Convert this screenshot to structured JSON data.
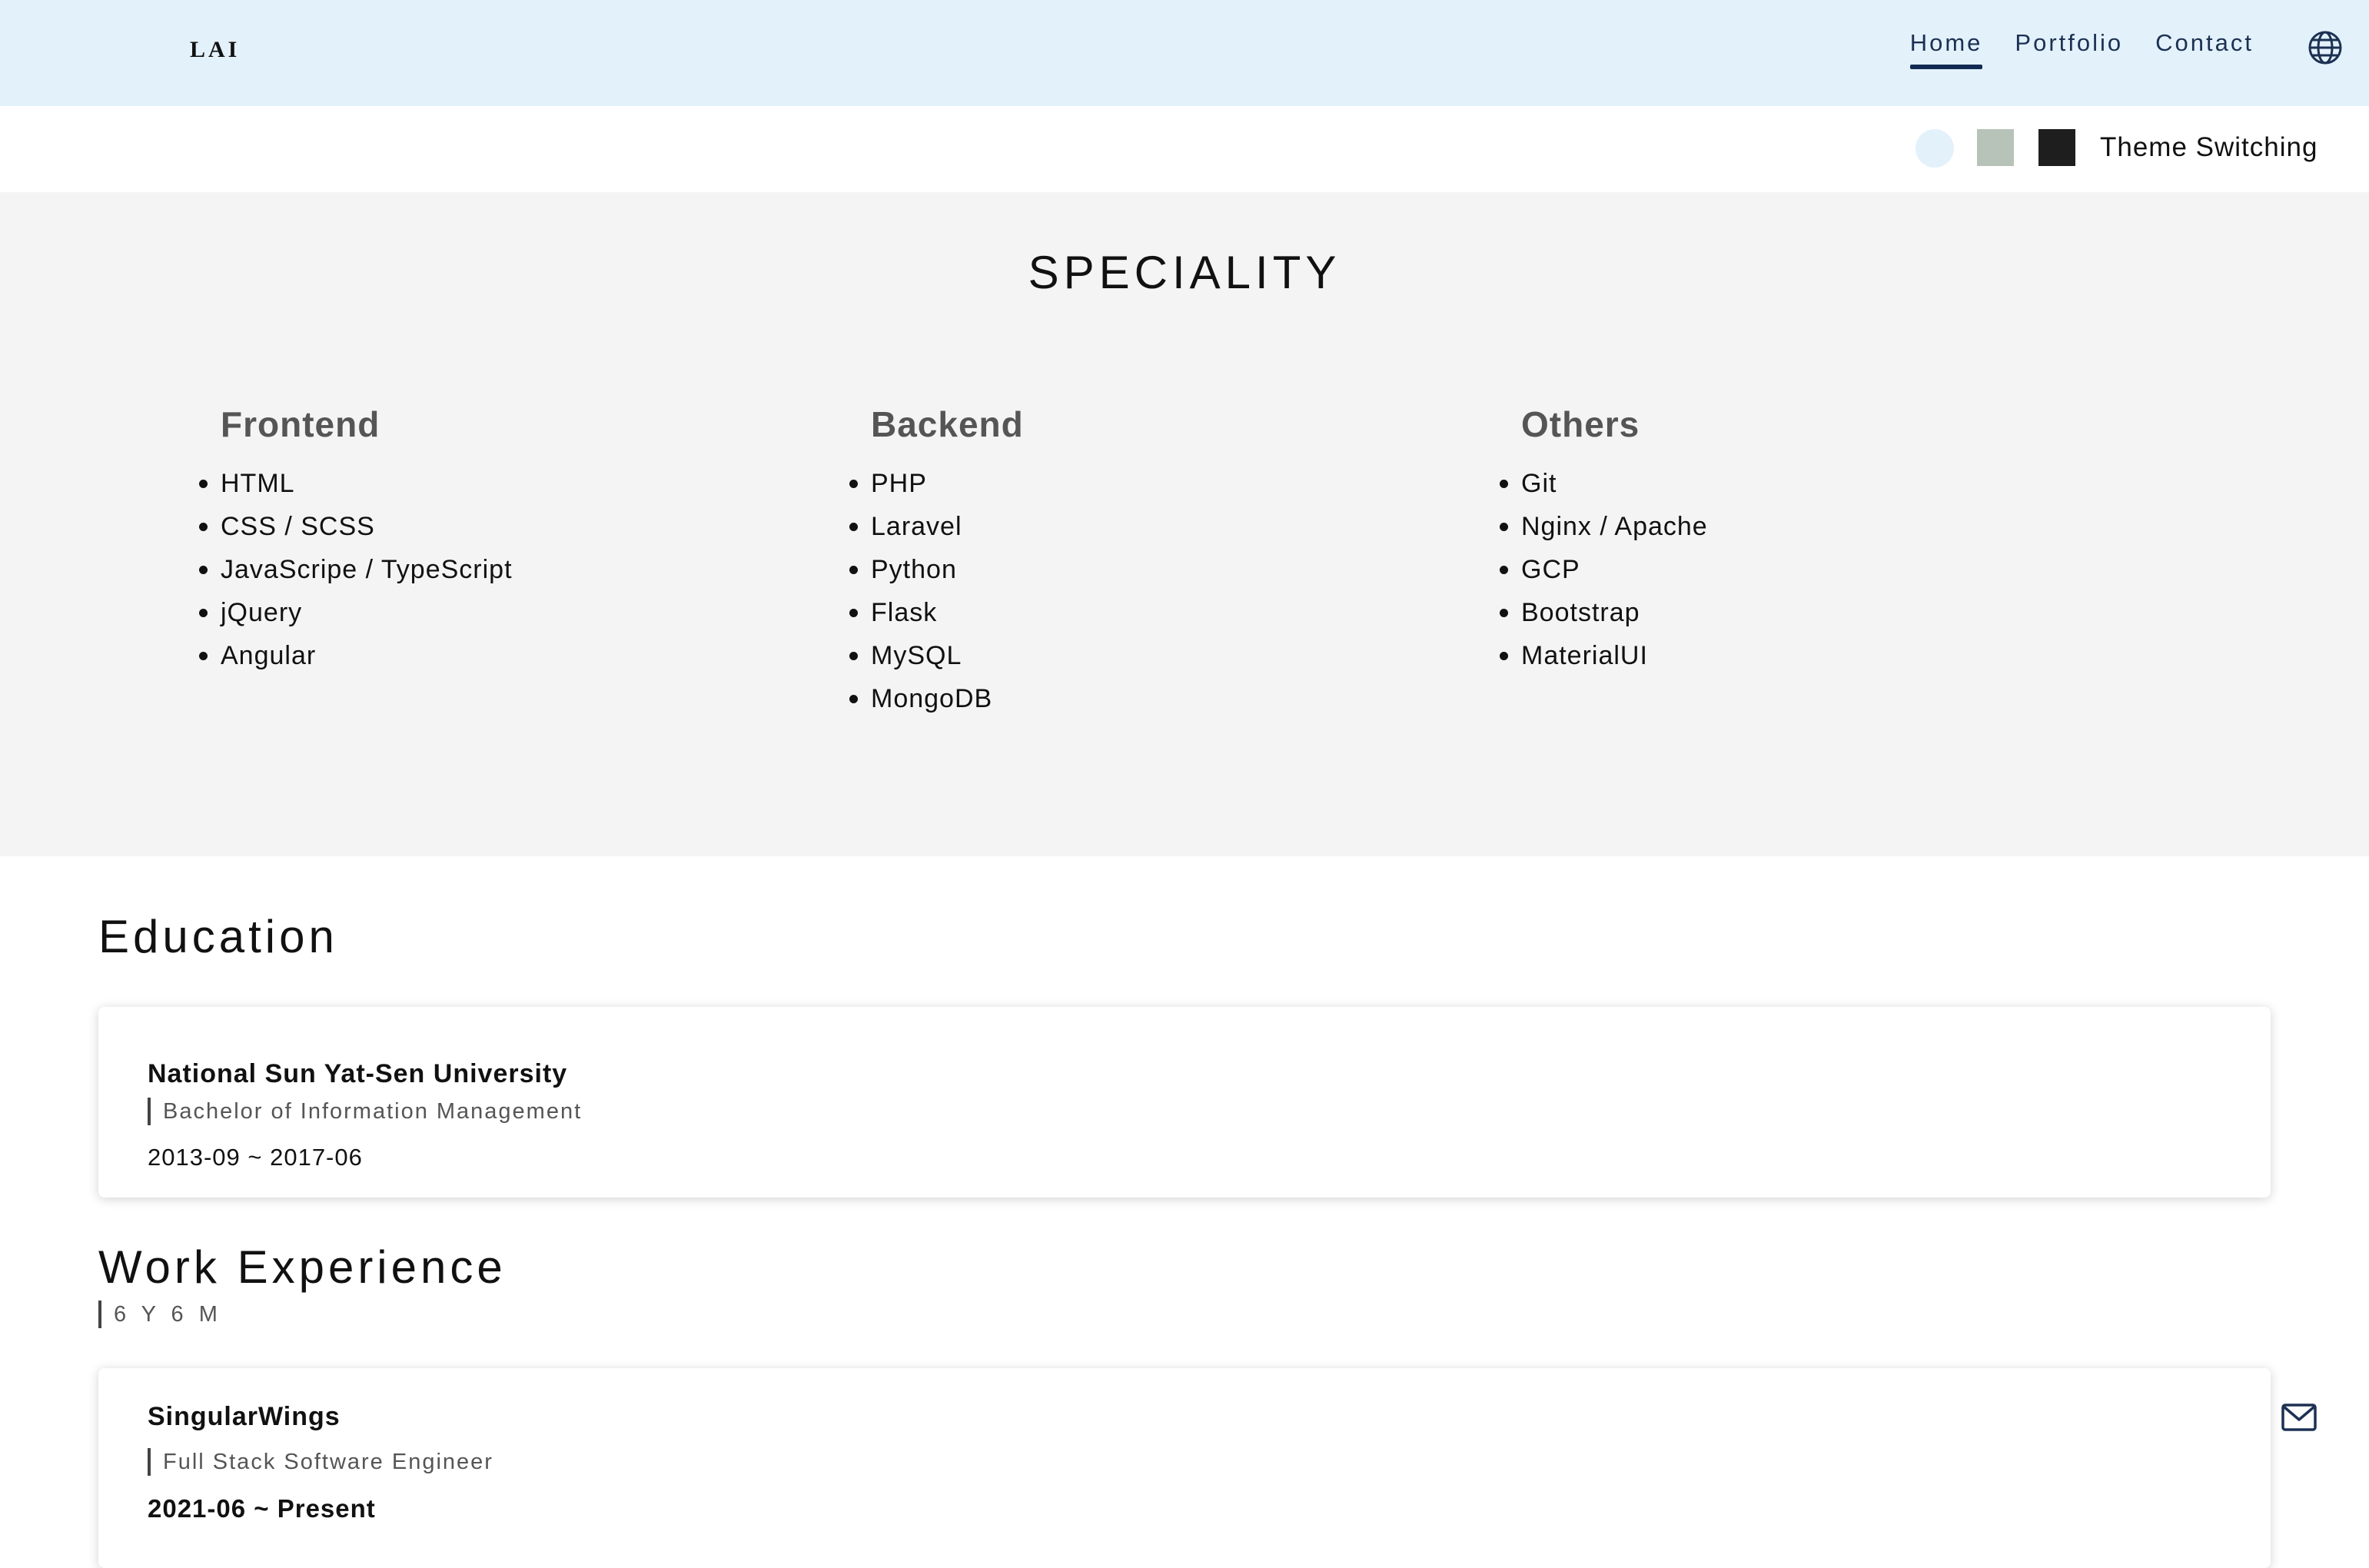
{
  "header": {
    "logo": "LAI",
    "nav": [
      {
        "label": "Home",
        "active": true
      },
      {
        "label": "Portfolio",
        "active": false
      },
      {
        "label": "Contact",
        "active": false
      }
    ],
    "language_icon": "globe-icon"
  },
  "theme": {
    "label": "Theme Switching",
    "swatches": [
      {
        "name": "light",
        "color": "#e3f1fb"
      },
      {
        "name": "sage",
        "color": "#b7c3b8"
      },
      {
        "name": "dark",
        "color": "#1e1e1e"
      }
    ]
  },
  "speciality": {
    "title": "SPECIALITY",
    "columns": [
      {
        "heading": "Frontend",
        "items": [
          "HTML",
          "CSS / SCSS",
          "JavaScripe / TypeScript",
          "jQuery",
          "Angular"
        ]
      },
      {
        "heading": "Backend",
        "items": [
          "PHP",
          "Laravel",
          "Python",
          "Flask",
          "MySQL",
          "MongoDB"
        ]
      },
      {
        "heading": "Others",
        "items": [
          "Git",
          "Nginx / Apache",
          "GCP",
          "Bootstrap",
          "MaterialUI"
        ]
      }
    ]
  },
  "education": {
    "title": "Education",
    "school": "National Sun Yat-Sen University",
    "degree": "Bachelor of Information Management",
    "period": "2013-09 ~ 2017-06"
  },
  "work": {
    "title": "Work Experience",
    "total": "6 Y 6 M",
    "company": "SingularWings",
    "role": "Full Stack Software Engineer",
    "period": "2021-06 ~ Present"
  },
  "floating": {
    "contact_icon": "mail-icon"
  }
}
